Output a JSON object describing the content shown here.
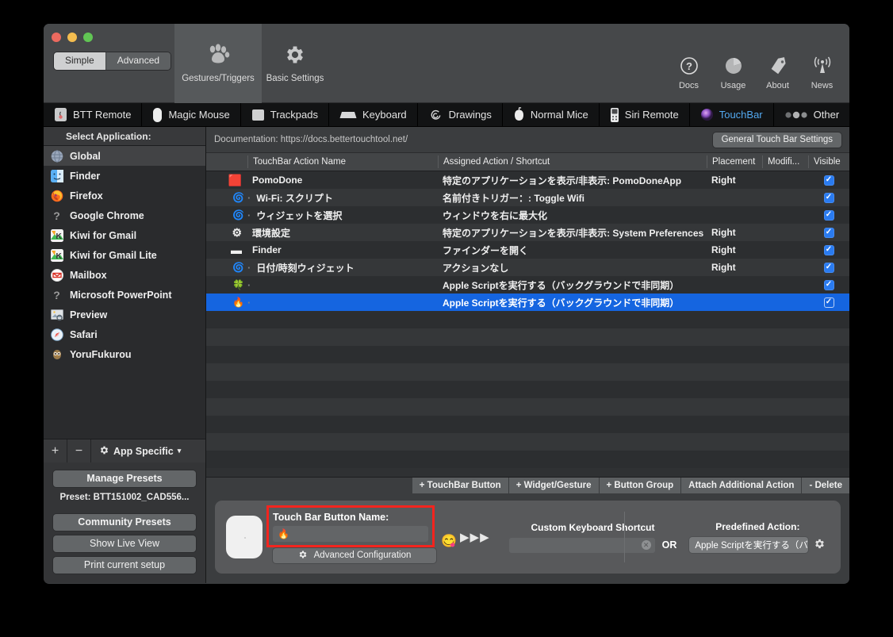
{
  "window": {
    "traffic_lights": [
      "close",
      "minimize",
      "maximize"
    ]
  },
  "toolbar": {
    "segmented": [
      {
        "label": "Simple",
        "active": false
      },
      {
        "label": "Advanced",
        "active": true
      }
    ],
    "tools": [
      {
        "label": "Gestures/Triggers",
        "icon": "paw-icon",
        "selected": true
      },
      {
        "label": "Basic Settings",
        "icon": "gear-icon",
        "selected": false
      }
    ],
    "right_tools": [
      {
        "label": "Docs",
        "icon": "question-circle-icon"
      },
      {
        "label": "Usage",
        "icon": "pie-chart-icon"
      },
      {
        "label": "About",
        "icon": "tag-icon"
      },
      {
        "label": "News",
        "icon": "broadcast-icon"
      }
    ]
  },
  "device_tabs": [
    {
      "label": "BTT Remote",
      "icon": "remote-icon",
      "active": false
    },
    {
      "label": "Magic Mouse",
      "icon": "magic-mouse-icon",
      "active": false
    },
    {
      "label": "Trackpads",
      "icon": "trackpad-icon",
      "active": false
    },
    {
      "label": "Keyboard",
      "icon": "keyboard-icon",
      "active": false
    },
    {
      "label": "Drawings",
      "icon": "spiral-icon",
      "active": false
    },
    {
      "label": "Normal Mice",
      "icon": "mouse-icon",
      "active": false
    },
    {
      "label": "Siri Remote",
      "icon": "siri-remote-icon",
      "active": false
    },
    {
      "label": "TouchBar",
      "icon": "touchbar-orb-icon",
      "active": true
    },
    {
      "label": "Other",
      "icon": "three-dots-icon",
      "active": false
    }
  ],
  "sidebar": {
    "header": "Select Application:",
    "apps": [
      {
        "label": "Global",
        "icon": "globe-icon",
        "selected": true
      },
      {
        "label": "Finder",
        "icon": "finder-icon",
        "selected": false
      },
      {
        "label": "Firefox",
        "icon": "firefox-icon",
        "selected": false
      },
      {
        "label": "Google Chrome",
        "icon": "unknown-app-icon",
        "selected": false
      },
      {
        "label": "Kiwi for Gmail",
        "icon": "kiwi-icon",
        "selected": false
      },
      {
        "label": "Kiwi for Gmail Lite",
        "icon": "kiwi-icon",
        "selected": false
      },
      {
        "label": "Mailbox",
        "icon": "mailbox-icon",
        "selected": false
      },
      {
        "label": "Microsoft PowerPoint",
        "icon": "unknown-app-icon",
        "selected": false
      },
      {
        "label": "Preview",
        "icon": "preview-icon",
        "selected": false
      },
      {
        "label": "Safari",
        "icon": "safari-icon",
        "selected": false
      },
      {
        "label": "YoruFukurou",
        "icon": "owl-icon",
        "selected": false
      }
    ],
    "tools": {
      "add": "+",
      "remove": "−",
      "app_specific": "App Specific",
      "caret": "▾"
    },
    "bottom_buttons": {
      "manage_presets": "Manage Presets",
      "preset_line": "Preset: BTT151002_CAD556...",
      "community_presets": "Community Presets",
      "show_live_view": "Show Live View",
      "print_current_setup": "Print current setup"
    }
  },
  "main": {
    "documentation": "Documentation: https://docs.bettertouchtool.net/",
    "general_settings_button": "General Touch Bar Settings",
    "table": {
      "columns": [
        "",
        "TouchBar Action Name",
        "Assigned Action / Shortcut",
        "Placement",
        "Modifi...",
        "Visible"
      ],
      "rows": [
        {
          "icon": "🟥",
          "icon_name": "pomodone-icon",
          "indent": false,
          "name": "PomoDone",
          "action": "特定のアプリケーションを表示/非表示: PomoDoneApp",
          "placement": "Right",
          "modifier": "",
          "visible": true,
          "selected": false
        },
        {
          "icon": "🌀",
          "icon_name": "widget-spiral-icon",
          "indent": true,
          "name": "Wi-Fi: スクリプト",
          "action": "名前付きトリガー：: Toggle Wifi",
          "placement": "",
          "modifier": "",
          "visible": true,
          "selected": false
        },
        {
          "icon": "🌀",
          "icon_name": "widget-spiral-icon",
          "indent": true,
          "name": "ウィジェットを選択",
          "action": "ウィンドウを右に最大化",
          "placement": "",
          "modifier": "",
          "visible": true,
          "selected": false
        },
        {
          "icon": "⚙",
          "icon_name": "system-prefs-icon",
          "indent": false,
          "name": "環境設定",
          "action": "特定のアプリケーションを表示/非表示: System Preferences",
          "placement": "Right",
          "modifier": "",
          "visible": true,
          "selected": false
        },
        {
          "icon": "▬",
          "icon_name": "finder-folder-icon",
          "indent": false,
          "name": "Finder",
          "action": "ファインダーを開く",
          "placement": "Right",
          "modifier": "",
          "visible": true,
          "selected": false
        },
        {
          "icon": "🌀",
          "icon_name": "widget-spiral-icon",
          "indent": true,
          "name": "日付/時刻ウィジェット",
          "action": "アクションなし",
          "placement": "Right",
          "modifier": "",
          "visible": true,
          "selected": false
        },
        {
          "icon": "🍀",
          "icon_name": "clover-icon",
          "indent": true,
          "name": "",
          "action": "Apple Scriptを実行する（バックグラウンドで非同期）",
          "placement": "",
          "modifier": "",
          "visible": true,
          "selected": false
        },
        {
          "icon": "🔥",
          "icon_name": "flame-icon",
          "indent": true,
          "name": "",
          "action": "Apple Scriptを実行する（バックグラウンドで非同期）",
          "placement": "",
          "modifier": "",
          "visible": true,
          "selected": true
        }
      ],
      "empty_row_count": 9
    },
    "action_buttons": [
      "+ TouchBar Button",
      "+ Widget/Gesture",
      "+ Button Group",
      "Attach Additional Action",
      "- Delete"
    ]
  },
  "config_panel": {
    "button_name_label": "Touch Bar Button Name:",
    "button_name_value": "🔥",
    "emoji_picker_icon": "😋",
    "advanced_configuration": "Advanced Configuration",
    "advanced_gear_icon": "gear-icon",
    "arrows": "▶▶▶",
    "keyboard_shortcut_label": "Custom Keyboard Shortcut",
    "keyboard_shortcut_value": "",
    "clear_icon": "✕",
    "or_label": "OR",
    "predefined_action_label": "Predefined Action:",
    "predefined_action_value": "Apple Scriptを実行する（バ",
    "predefined_caret": "▾",
    "settings_gear_icon": "gear-icon"
  },
  "colors": {
    "accent_blue": "#1565e0",
    "checkbox_blue": "#2a7bf0",
    "highlight_red": "#f4241e",
    "tab_active_text": "#53a9f0"
  }
}
